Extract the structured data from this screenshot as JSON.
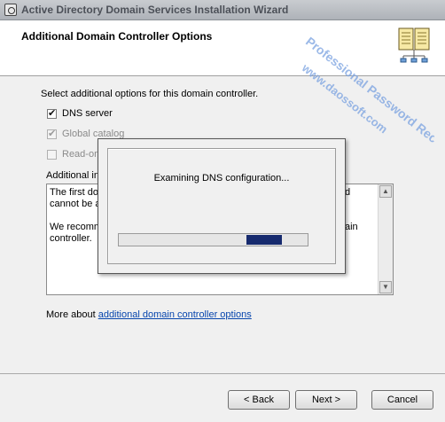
{
  "window": {
    "title": "Active Directory Domain Services Installation Wizard"
  },
  "header": {
    "title": "Additional Domain Controller Options"
  },
  "instructions": "Select additional options for this domain controller.",
  "options": [
    {
      "label": "DNS server",
      "checked": true,
      "enabled": true
    },
    {
      "label": "Global catalog",
      "checked": true,
      "enabled": false
    },
    {
      "label": "Read-on",
      "checked": false,
      "enabled": false
    }
  ],
  "info": {
    "label": "Additional inf",
    "lines": [
      "The first do",
      "cannot be a",
      "",
      "We recomm",
      "controller."
    ],
    "right_fragments": [
      "d",
      "",
      "",
      "ain",
      ""
    ]
  },
  "more_link": {
    "prefix": "More about ",
    "text": "additional domain controller options"
  },
  "progress_dialog": {
    "message": "Examining DNS configuration...",
    "progress": 0.25
  },
  "buttons": {
    "back": "< Back",
    "next": "Next >",
    "cancel": "Cancel"
  },
  "watermark": {
    "line1": "Professional Password Recovery",
    "line2": "www.daossoft.com",
    "color": "#7aa2e0"
  },
  "colors": {
    "progress_fill": "#162a6e",
    "link": "#0645ad"
  }
}
